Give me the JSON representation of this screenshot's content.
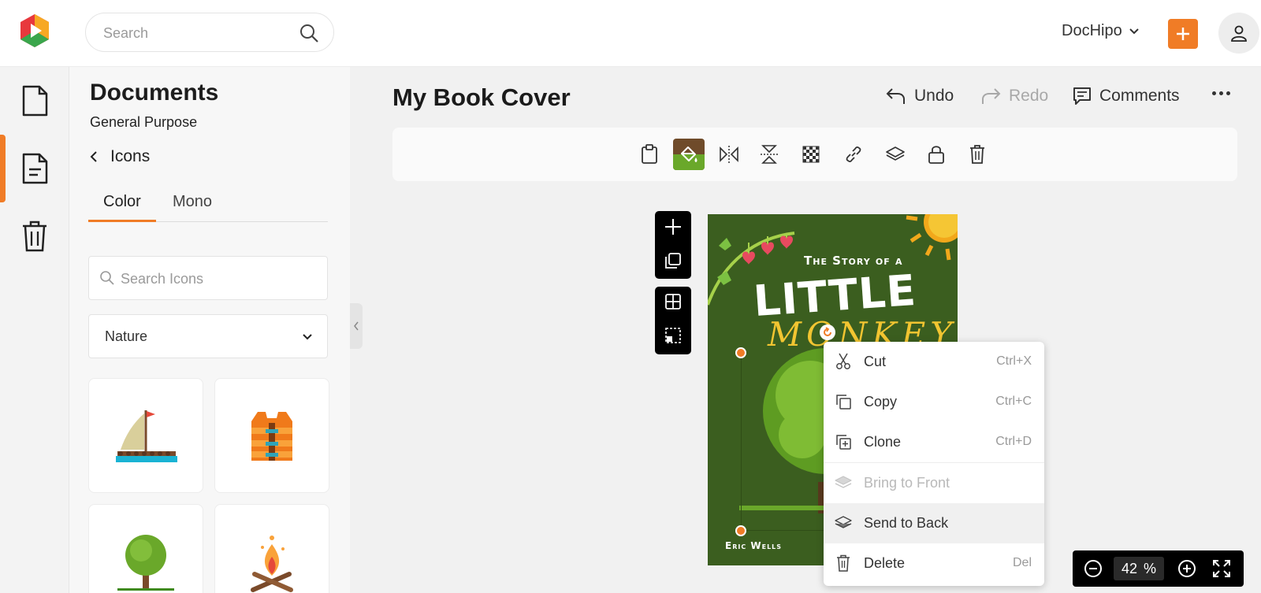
{
  "header": {
    "search_placeholder": "Search",
    "workspace": "DocHipo"
  },
  "rail": {
    "items": [
      {
        "name": "document",
        "active": false
      },
      {
        "name": "text-document",
        "active": true
      },
      {
        "name": "trash",
        "active": false
      }
    ]
  },
  "panel": {
    "title": "Documents",
    "subtitle": "General Purpose",
    "back_label": "Icons",
    "tabs": [
      {
        "label": "Color",
        "active": true
      },
      {
        "label": "Mono",
        "active": false
      }
    ],
    "search_placeholder": "Search Icons",
    "category": "Nature",
    "tiles": [
      "sailboat-icon",
      "life-vest-icon",
      "tree-icon",
      "campfire-icon"
    ]
  },
  "document": {
    "title": "My Book Cover",
    "undo": "Undo",
    "redo": "Redo",
    "comments": "Comments"
  },
  "cover": {
    "line1": "The Story of a",
    "line2": "LITTLE",
    "line3": "MONKEY",
    "author": "Eric Wells"
  },
  "context_menu": {
    "items": [
      {
        "label": "Cut",
        "shortcut": "Ctrl+X",
        "icon": "scissors-icon",
        "disabled": false
      },
      {
        "label": "Copy",
        "shortcut": "Ctrl+C",
        "icon": "copy-icon",
        "disabled": false
      },
      {
        "label": "Clone",
        "shortcut": "Ctrl+D",
        "icon": "clone-icon",
        "disabled": false
      },
      {
        "label": "Bring to Front",
        "shortcut": "",
        "icon": "bring-front-icon",
        "disabled": true
      },
      {
        "label": "Send to Back",
        "shortcut": "",
        "icon": "send-back-icon",
        "disabled": false
      },
      {
        "label": "Delete",
        "shortcut": "Del",
        "icon": "trash-icon",
        "disabled": false
      }
    ]
  },
  "zoom": {
    "value": "42",
    "unit": "%"
  },
  "colors": {
    "accent": "#f07c26",
    "cover_green": "#3b5e1f",
    "title_yellow": "#f2c531"
  }
}
